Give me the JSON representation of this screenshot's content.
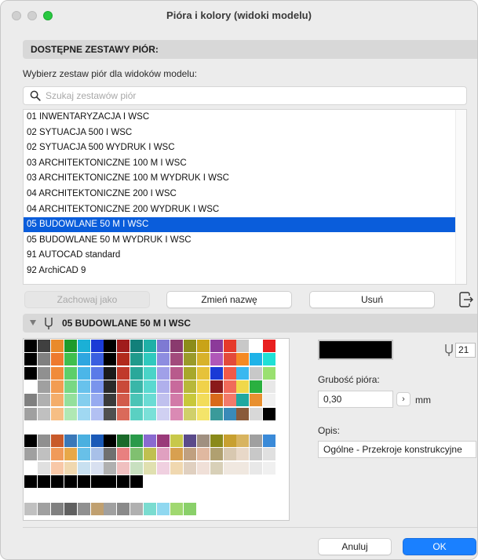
{
  "window": {
    "title": "Pióra i kolory (widoki modelu)"
  },
  "section": {
    "title": "DOSTĘPNE ZESTAWY PIÓR:"
  },
  "prompt": "Wybierz zestaw piór dla widoków modelu:",
  "search": {
    "placeholder": "Szukaj zestawów piór",
    "value": ""
  },
  "pen_sets": [
    "01 INWENTARYZACJA I  WSC",
    "02 SYTUACJA 500 I WSC",
    "02 SYTUACJA 500 WYDRUK I WSC",
    "03 ARCHITEKTONICZNE 100 M I WSC",
    "03 ARCHITEKTONICZNE 100 M WYDRUK I WSC",
    "04 ARCHITEKTONICZNE 200 I WSC",
    "04 ARCHITEKTONICZNE 200 WYDRUK I WSC",
    "05 BUDOWLANE 50 M I WSC",
    "05 BUDOWLANE 50 M WYDRUK I WSC",
    "91 AUTOCAD standard",
    "92 ArchiCAD 9"
  ],
  "selected_index": 7,
  "buttons": {
    "save_as": "Zachowaj jako",
    "rename": "Zmień nazwę",
    "delete": "Usuń",
    "cancel": "Anuluj",
    "ok": "OK"
  },
  "current_set": {
    "name": "05 BUDOWLANE 50 M I WSC"
  },
  "pen": {
    "number": "21",
    "color": "#000000",
    "weight_label": "Grubość pióra:",
    "weight_value": "0,30",
    "weight_unit": "mm",
    "description_label": "Opis:",
    "description_value": "Ogólne - Przekroje konstrukcyjne"
  },
  "icons": {
    "search": "search-icon",
    "pen": "pen-icon",
    "export": "export-icon",
    "disclosure": "disclosure-triangle-icon",
    "stepper": "chevron-right-icon"
  },
  "palette": [
    [
      "#000000",
      "#404040",
      "#e98a2b",
      "#1e9b2b",
      "#1bb0d6",
      "#1a3bd6",
      "#000000",
      "#a01c1c",
      "#12807a",
      "#1fb0a7",
      "#7e7ad3",
      "#8a3a6e",
      "#8c8c1a",
      "#c9a318",
      "#8c3a9a",
      "#e63a2a",
      "#c8c8c8",
      "#ffffff",
      "#e81f1f"
    ],
    [
      "#000000",
      "#808080",
      "#ee7a2e",
      "#3fbf4e",
      "#2ea6e0",
      "#3a5fe0",
      "#000000",
      "#b22a1c",
      "#1f9a8c",
      "#2fc9be",
      "#8d8de0",
      "#a24a7c",
      "#9a9a2a",
      "#d8b22a",
      "#b057b8",
      "#e34a3a",
      "#f58a24",
      "#1fb3e8",
      "#1fe0d6"
    ],
    [
      "#000000",
      "#909090",
      "#f08b3a",
      "#5ccf6a",
      "#4bb6e8",
      "#5a7ae8",
      "#1a1a1a",
      "#c0392b",
      "#2aa89a",
      "#4ad4c8",
      "#a0a0e8",
      "#b85a8c",
      "#a8a82a",
      "#e6c23a",
      "#1a3ad6",
      "#f05a4a",
      "#3ab8f0",
      "#c8c8c8",
      "#9ae070"
    ],
    [
      "#ffffff",
      "#a0a0a0",
      "#f29c52",
      "#78d884",
      "#68c2ec",
      "#7a94ec",
      "#2a2a2a",
      "#c94a3a",
      "#3ab6a8",
      "#5ad9d0",
      "#b0b0ec",
      "#c86a9c",
      "#b8b83a",
      "#f0d24a",
      "#8a1a1a",
      "#f06a5a",
      "#f0d84a",
      "#2ab040",
      "#e8e8e8"
    ],
    [
      "#808080",
      "#b0b0b0",
      "#f4ad6a",
      "#94e09c",
      "#84ceee",
      "#96aaf0",
      "#3a3a3a",
      "#d25a4a",
      "#4ac4b6",
      "#6adcd4",
      "#c0c0ee",
      "#d27aa8",
      "#c8c83a",
      "#f2dc5a",
      "#d86a1a",
      "#f27a6a",
      "#20a8a0",
      "#e89030",
      "#f0f0f0"
    ],
    [
      "#a0a0a0",
      "#c0c0c0",
      "#f6be84",
      "#b0e8b4",
      "#a0d8f2",
      "#b2c0f2",
      "#505050",
      "#da6a5a",
      "#5ad0c2",
      "#7ae0d8",
      "#d0d0f2",
      "#da8ab4",
      "#d0d06a",
      "#f4e46a",
      "#3a9a9a",
      "#3a8ab8",
      "#8a5a3a",
      "#d8d8d8",
      "#000000"
    ],
    [
      "#ffffff",
      "#ffffff",
      "#ffffff",
      "#ffffff",
      "#ffffff",
      "#ffffff",
      "#ffffff",
      "#ffffff",
      "#ffffff",
      "#ffffff",
      "#ffffff",
      "#ffffff",
      "#ffffff",
      "#ffffff",
      "#ffffff",
      "#ffffff",
      "#ffffff",
      "#ffffff",
      "#ffffff"
    ],
    [
      "#000000",
      "#909090",
      "#c85a2a",
      "#3a78b8",
      "#4ab0e0",
      "#1a5ab8",
      "#000000",
      "#1a6a2a",
      "#2a9a4a",
      "#8a6ad0",
      "#9a3a7a",
      "#c8c84a",
      "#5a4a8a",
      "#a09080",
      "#8a8a1a",
      "#c8a030",
      "#d8b460",
      "#a0a0a0",
      "#3a8ad8"
    ],
    [
      "#a0a0a0",
      "#c0c0c0",
      "#f09a5a",
      "#e8a848",
      "#68c0e8",
      "#a8c0e8",
      "#707070",
      "#e88080",
      "#80c070",
      "#c0c050",
      "#e0a0c0",
      "#d8a050",
      "#c0a080",
      "#e0b8a0",
      "#b0a070",
      "#d8c8b0",
      "#e8d8c8",
      "#c8c8c8",
      "#e0e0e0"
    ],
    [
      "#ffffff",
      "#e0e0e0",
      "#f8c8a8",
      "#f0d8b0",
      "#c8e0f0",
      "#d8e0f0",
      "#b0b0b0",
      "#f0c0c0",
      "#c8e0c0",
      "#e0e0b0",
      "#f0d0e0",
      "#f0d8b0",
      "#e0d0c0",
      "#f0e0d8",
      "#d8d0b8",
      "#f0e8e0",
      "#f0e8e0",
      "#e8e8e8",
      "#f0f0f0"
    ],
    [
      "#000000",
      "#000000",
      "#000000",
      "#000000",
      "#000000",
      "#000000",
      "#000000",
      "#000000",
      "#000000",
      "#ffffff",
      "#ffffff",
      "#ffffff",
      "#ffffff",
      "#ffffff",
      "#ffffff",
      "#ffffff",
      "#ffffff",
      "#ffffff",
      "#ffffff"
    ],
    [
      "#ffffff",
      "#ffffff",
      "#ffffff",
      "#ffffff",
      "#ffffff",
      "#ffffff",
      "#ffffff",
      "#ffffff",
      "#ffffff",
      "#ffffff",
      "#ffffff",
      "#ffffff",
      "#ffffff",
      "#ffffff",
      "#ffffff",
      "#ffffff",
      "#ffffff",
      "#ffffff",
      "#ffffff"
    ],
    [
      "#c0c0c0",
      "#a0a0a0",
      "#808080",
      "#606060",
      "#909090",
      "#c0a070",
      "#a0a0a0",
      "#8a8a8a",
      "#b0b0b0",
      "#7adcd0",
      "#90d8f0",
      "#a0d870",
      "#8ad06a",
      "#ffffff",
      "#ffffff",
      "#ffffff",
      "#ffffff",
      "#ffffff",
      "#ffffff"
    ]
  ]
}
